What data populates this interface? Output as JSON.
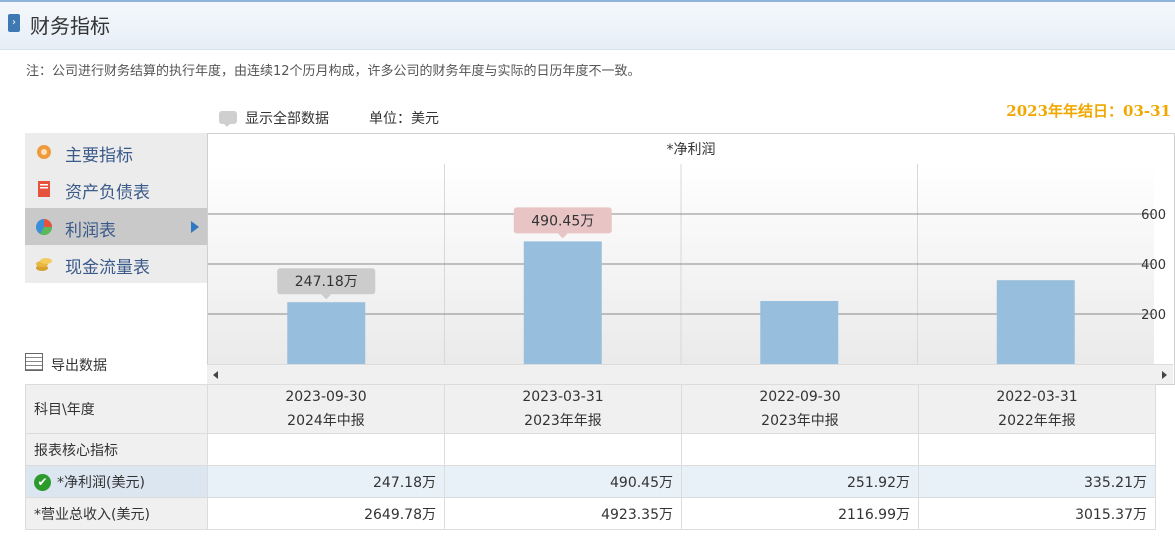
{
  "header": {
    "title": "财务指标"
  },
  "note": "注：公司进行财务结算的执行年度，由连续12个历月构成，许多公司的财务年度与实际的日历年度不一致。",
  "toolbar": {
    "show_all": "显示全部数据",
    "unit": "单位：美元"
  },
  "year_end": "2023年年结日：03-31",
  "sidebar": {
    "items": [
      {
        "label": "主要指标",
        "icon": "gear-flower-icon"
      },
      {
        "label": "资产负债表",
        "icon": "document-icon"
      },
      {
        "label": "利润表",
        "icon": "pie-chart-icon",
        "active": true
      },
      {
        "label": "现金流量表",
        "icon": "coins-icon"
      }
    ]
  },
  "export_label": "导出数据",
  "chart_data": {
    "type": "bar",
    "title": "*净利润",
    "categories": [
      "2023-09-30",
      "2023-03-31",
      "2022-09-30",
      "2022-03-31"
    ],
    "values": [
      247.18,
      490.45,
      251.92,
      335.21
    ],
    "y_ticks": [
      "600",
      "400",
      "200"
    ],
    "ylim": [
      0,
      800
    ],
    "labels": [
      {
        "index": 0,
        "text": "247.18万",
        "color": "#cccccc"
      },
      {
        "index": 1,
        "text": "490.45万",
        "color": "#e8c4c4"
      }
    ],
    "bar_color": "#97bfdd",
    "grid": true
  },
  "table": {
    "corner": "科目\\年度",
    "columns": [
      {
        "date": "2023-09-30",
        "period": "2024年中报"
      },
      {
        "date": "2023-03-31",
        "period": "2023年年报"
      },
      {
        "date": "2022-09-30",
        "period": "2023年中报"
      },
      {
        "date": "2022-03-31",
        "period": "2022年年报"
      }
    ],
    "section": "报表核心指标",
    "rows": [
      {
        "label": "*净利润(美元)",
        "values": [
          "247.18万",
          "490.45万",
          "251.92万",
          "335.21万"
        ]
      },
      {
        "label": "*营业总收入(美元)",
        "values": [
          "2649.78万",
          "4923.35万",
          "2116.99万",
          "3015.37万"
        ]
      }
    ]
  }
}
